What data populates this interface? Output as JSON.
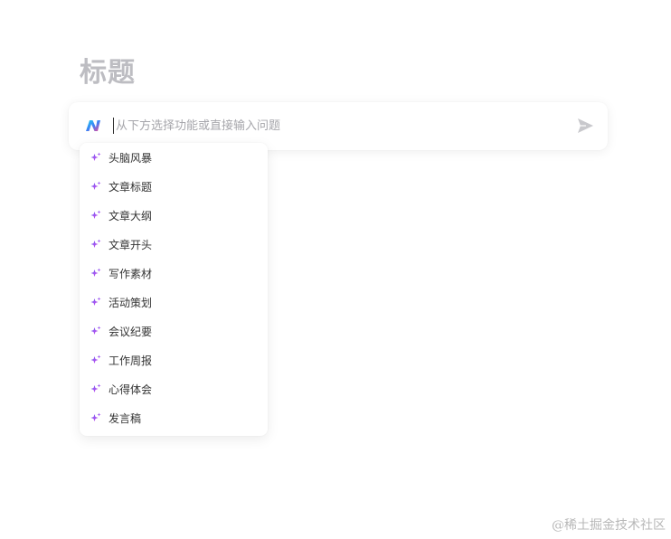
{
  "document": {
    "title": "标题"
  },
  "ai_bar": {
    "logo_icon": "ai-logo-icon",
    "input_value": "",
    "input_placeholder": "从下方选择功能或直接输入问题",
    "send_icon": "send-icon"
  },
  "menu": {
    "item_icon": "sparkle-icon",
    "items": [
      {
        "label": "头脑风暴"
      },
      {
        "label": "文章标题"
      },
      {
        "label": "文章大纲"
      },
      {
        "label": "文章开头"
      },
      {
        "label": "写作素材"
      },
      {
        "label": "活动策划"
      },
      {
        "label": "会议纪要"
      },
      {
        "label": "工作周报"
      },
      {
        "label": "心得体会"
      },
      {
        "label": "发言稿"
      }
    ]
  },
  "watermark": {
    "text": "@稀土掘金技术社区"
  },
  "colors": {
    "title": "#bdbdc2",
    "placeholder": "#a6a6ab",
    "send_icon": "#c8c8cc",
    "sparkle_purple": "#8b5cf6",
    "logo_blue": "#3b82f6",
    "logo_pink": "#ec4899"
  }
}
